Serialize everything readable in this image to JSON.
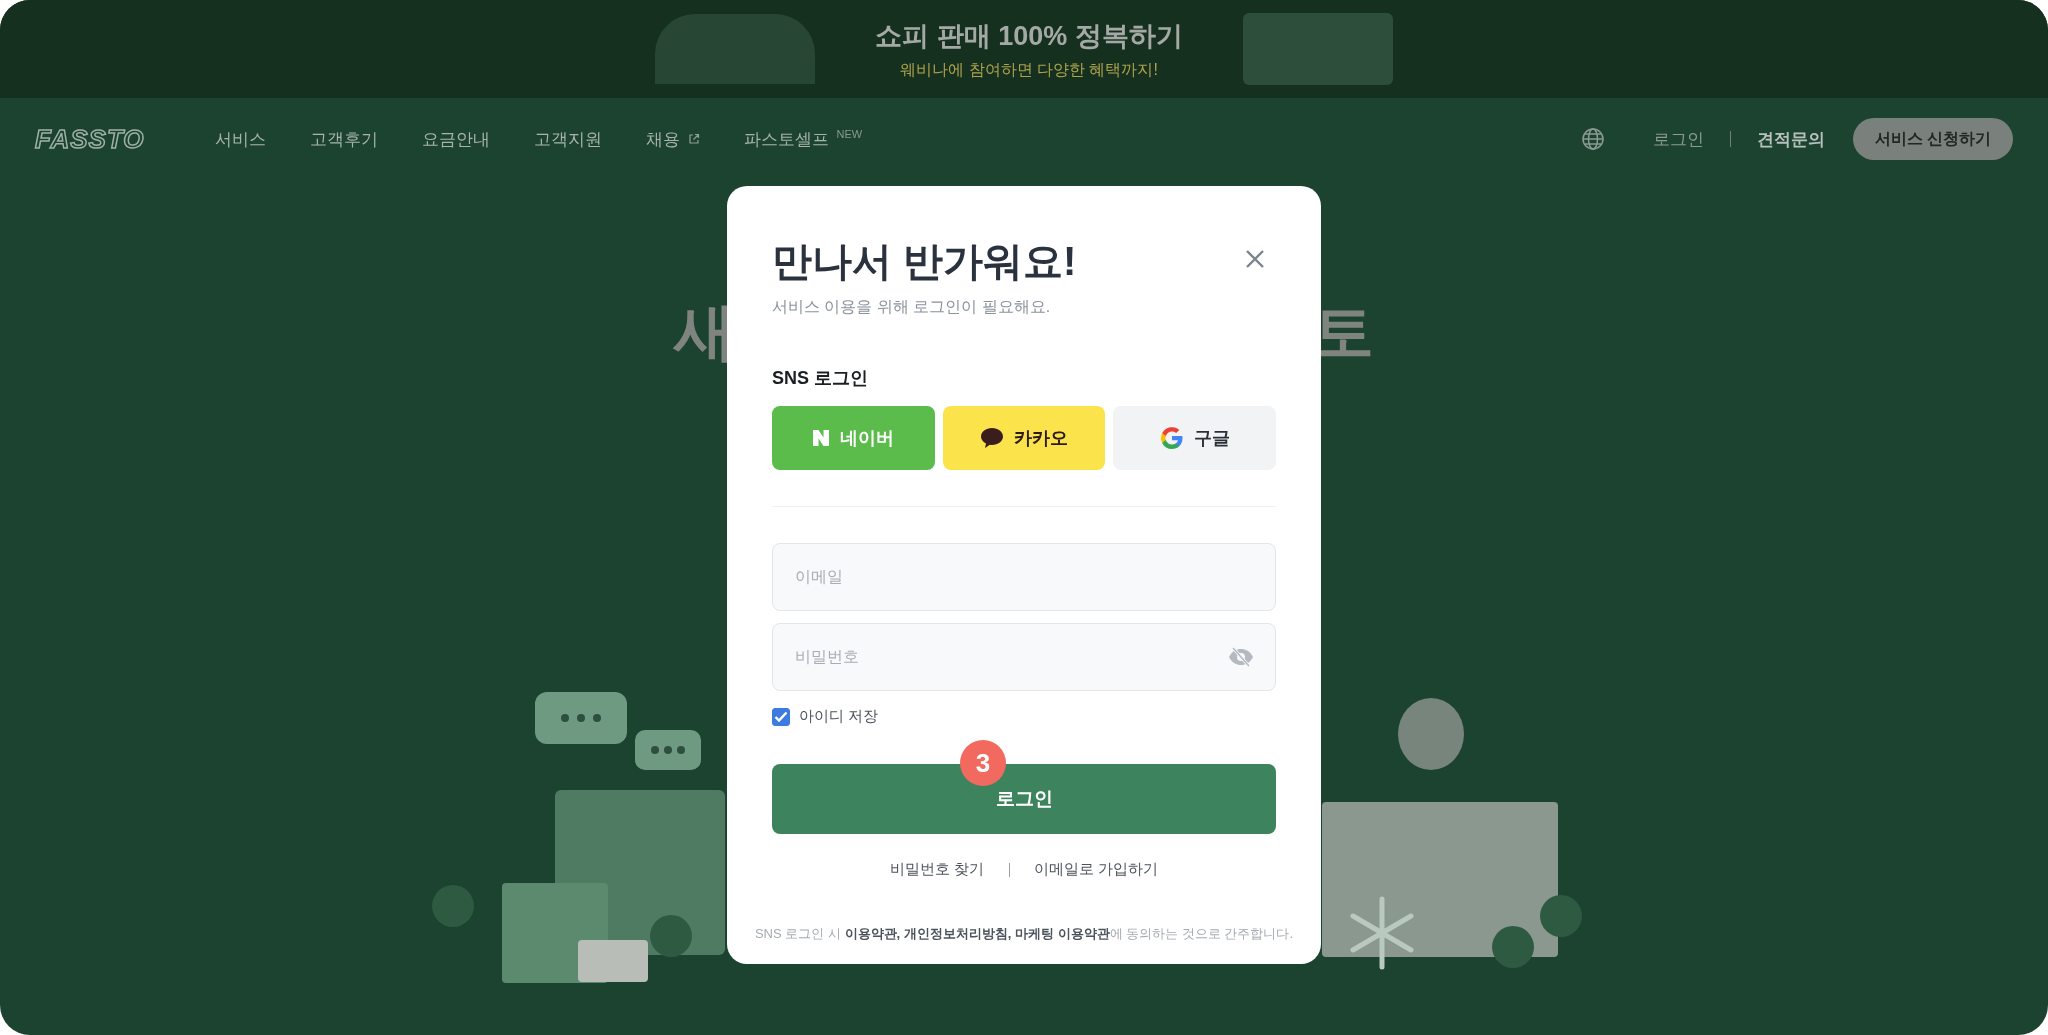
{
  "banner": {
    "title": "쇼피 판매 100% 정복하기",
    "subtitle": "웨비나에 참여하면 다양한 혜택까지!"
  },
  "nav": {
    "logo": "FASSTO",
    "items": [
      {
        "label": "서비스",
        "kind": "plain"
      },
      {
        "label": "고객후기",
        "kind": "plain"
      },
      {
        "label": "요금안내",
        "kind": "plain"
      },
      {
        "label": "고객지원",
        "kind": "plain"
      },
      {
        "label": "채용",
        "kind": "external"
      },
      {
        "label": "파스토셀프",
        "kind": "new",
        "badge": "NEW"
      }
    ],
    "login": "로그인",
    "quote": "견적문의",
    "cta": "서비스 신청하기"
  },
  "hero": {
    "title_left": "새",
    "title_right": "토"
  },
  "modal": {
    "title": "만나서 반가워요!",
    "subtitle": "서비스 이용을 위해 로그인이 필요해요.",
    "sns_label": "SNS 로그인",
    "sns_buttons": [
      {
        "label": "네이버",
        "kind": "naver"
      },
      {
        "label": "카카오",
        "kind": "kakao"
      },
      {
        "label": "구글",
        "kind": "google"
      }
    ],
    "email": {
      "placeholder": "이메일"
    },
    "password": {
      "placeholder": "비밀번호"
    },
    "remember": {
      "label": "아이디 저장",
      "checked": true
    },
    "login_button": "로그인",
    "step_badge": "3",
    "links": [
      "비밀번호 찾기",
      "이메일로 가입하기"
    ],
    "terms": "SNS 로그인 시 **이용약관, 개인정보처리방침, 마케팅 이용약관**에 동의하는 것으로 간주합니다."
  }
}
